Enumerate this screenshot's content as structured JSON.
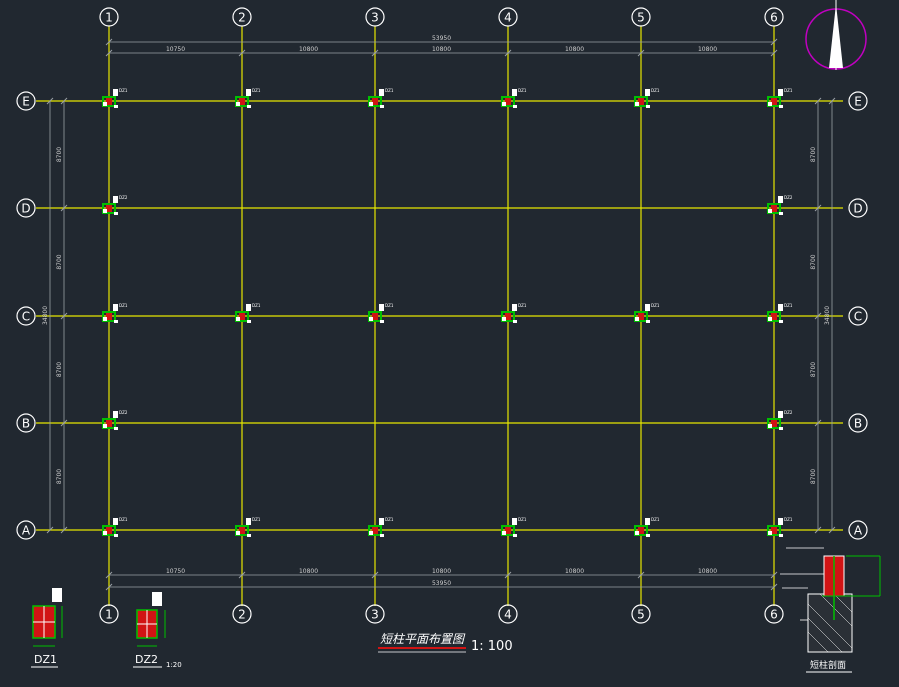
{
  "colors": {
    "background": "#212830",
    "grid_line": "#e6e600",
    "dim_line": "#9aa0a6",
    "bubble": "#ffffff",
    "column_section": "#00c000",
    "column_fill": "#d11414",
    "north_circle": "#c000c0"
  },
  "grid": {
    "cols": [
      "1",
      "2",
      "3",
      "4",
      "5",
      "6"
    ],
    "rows": [
      "E",
      "D",
      "C",
      "B",
      "A"
    ]
  },
  "dimensions": {
    "top_total": "53950",
    "top_spans": [
      "10750",
      "10800",
      "10800",
      "10800",
      "10800"
    ],
    "bottom_spans": [
      "10750",
      "10800",
      "10800",
      "10800",
      "10800"
    ],
    "bottom_total": "53950",
    "left_spans": [
      "8700",
      "8700",
      "8700",
      "8700"
    ],
    "left_total": "34800",
    "right_spans": [
      "8700",
      "8700",
      "8700",
      "8700"
    ],
    "right_total": "34800"
  },
  "column_tags": {
    "full": "DZ1",
    "edge": "DZ2"
  },
  "title": {
    "text": "短柱平面布置图",
    "scale": "1: 100"
  },
  "details": {
    "dz1_label": "DZ1",
    "dz2_label": "DZ2",
    "dz2_scale": "1:20",
    "section_title": "短柱剖面"
  },
  "icons": {
    "north": "north-arrow-icon"
  }
}
